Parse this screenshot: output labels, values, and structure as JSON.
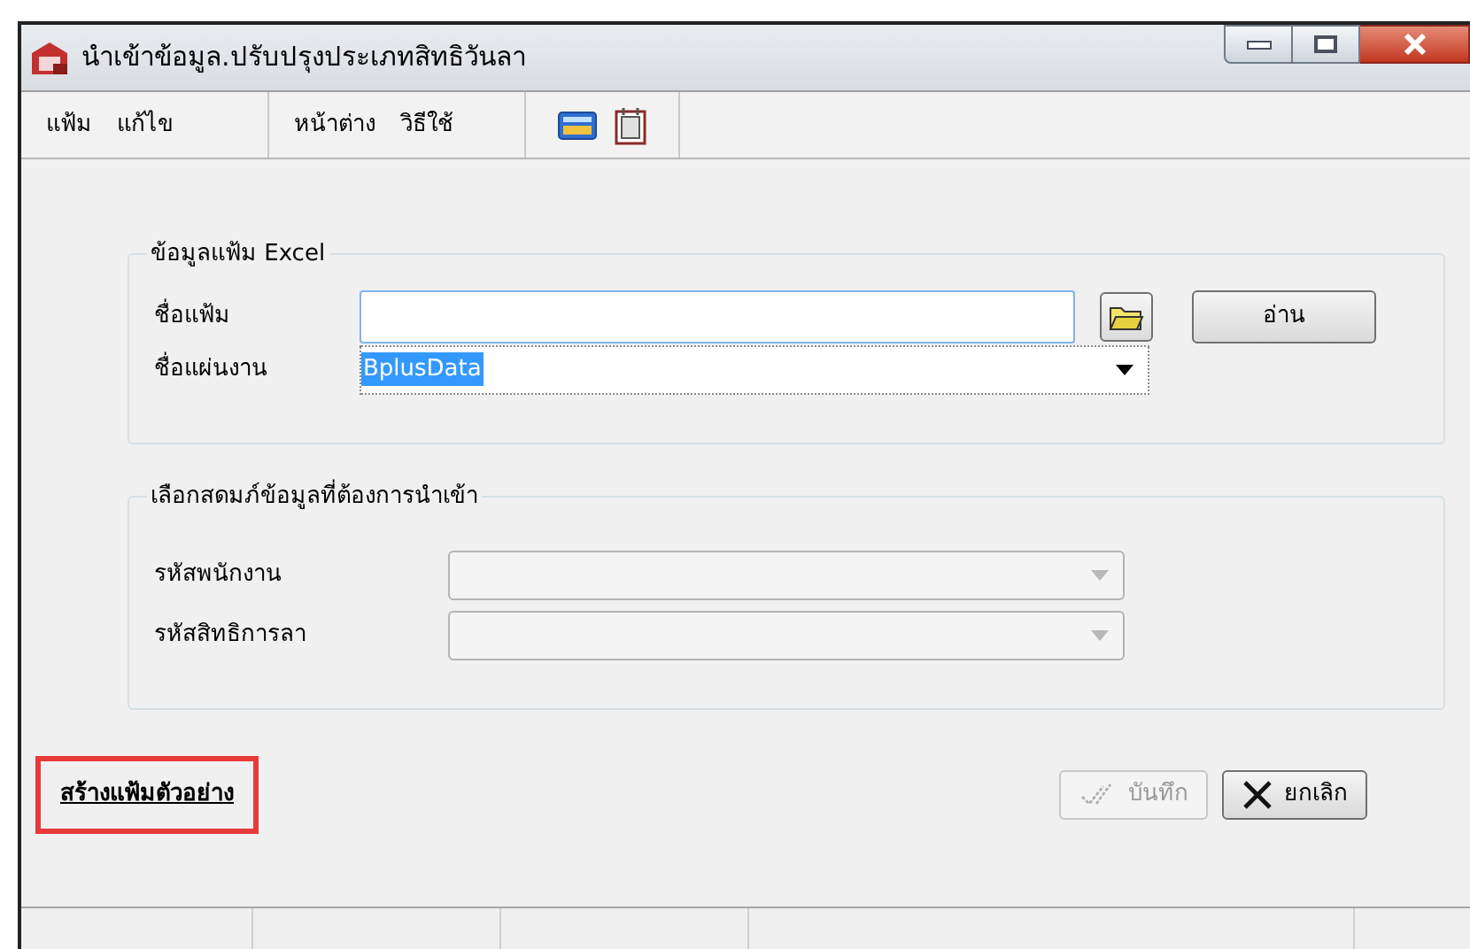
{
  "window": {
    "title": "นำเข้าข้อมูล.ปรับปรุงประเภทสิทธิวันลา"
  },
  "menu": [
    {
      "label": "แฟ้ม"
    },
    {
      "label": "แก้ไข"
    },
    {
      "label": "หน้าต่าง"
    },
    {
      "label": "วิธีใช้"
    }
  ],
  "excel_group": {
    "title": "ข้อมูลแฟ้ม Excel",
    "file_field": {
      "label": "ชื่อแฟ้ม"
    },
    "read_button": "อ่าน",
    "sheet_field": {
      "label": "ชื่อแผ่นงาน",
      "value": "BplusData",
      "highlighted": true
    }
  },
  "import_group": {
    "title": "เลือกสดมภ์ข้อมูลที่ต้องการนำเข้า",
    "fields": [
      {
        "label": "รหัสพนักงาน",
        "disabled": true
      },
      {
        "label": "รหัสสิทธิการลา",
        "disabled": true
      }
    ]
  },
  "sample_link": "สร้างแฟ้มตัวอย่าง",
  "buttons": [
    {
      "kind": "save",
      "label": "บันทึก",
      "disabled": true
    },
    {
      "kind": "cancel",
      "label": "ยกเลิก",
      "disabled": false
    }
  ]
}
